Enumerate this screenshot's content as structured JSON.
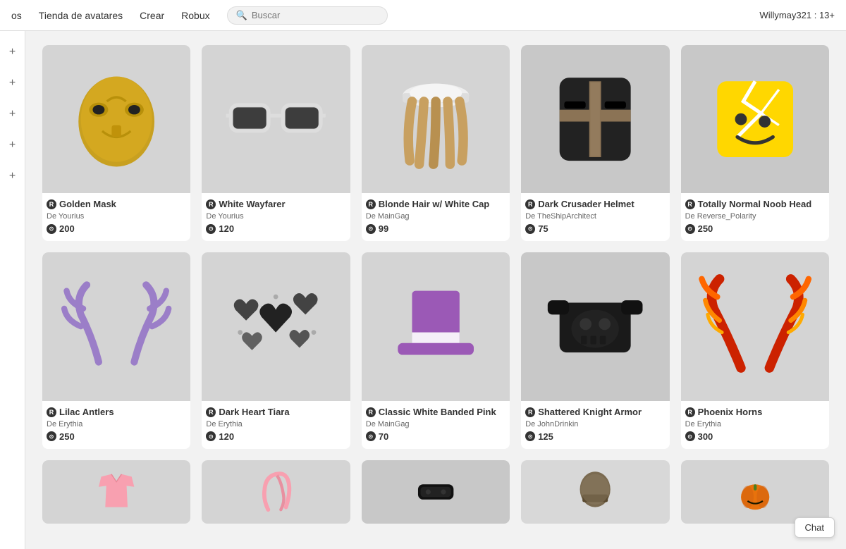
{
  "nav": {
    "items": [
      "os",
      "Tienda de avatares",
      "Crear",
      "Robux"
    ],
    "search_placeholder": "Buscar",
    "user": "Willymay321 : 13+"
  },
  "sidebar": {
    "icons": [
      "+",
      "+",
      "+",
      "+",
      "+"
    ]
  },
  "items": [
    {
      "id": "golden-mask",
      "name": "Golden Mask",
      "creator": "De Yourius",
      "price": "200",
      "img_type": "golden-mask"
    },
    {
      "id": "white-wayfarer",
      "name": "White Wayfarer",
      "creator": "De Yourius",
      "price": "120",
      "img_type": "white-wayfarer"
    },
    {
      "id": "blonde-hair",
      "name": "Blonde Hair w/ White Cap",
      "creator": "De MainGag",
      "price": "99",
      "img_type": "blonde-hair"
    },
    {
      "id": "dark-crusader",
      "name": "Dark Crusader Helmet",
      "creator": "De TheShipArchitect",
      "price": "75",
      "img_type": "dark-crusader"
    },
    {
      "id": "noob-head",
      "name": "Totally Normal Noob Head",
      "creator": "De Reverse_Polarity",
      "price": "250",
      "img_type": "noob-head"
    },
    {
      "id": "lilac-antlers",
      "name": "Lilac Antlers",
      "creator": "De Erythia",
      "price": "250",
      "img_type": "lilac-antlers"
    },
    {
      "id": "dark-heart",
      "name": "Dark Heart Tiara",
      "creator": "De Erythia",
      "price": "120",
      "img_type": "dark-heart"
    },
    {
      "id": "classic-pink",
      "name": "Classic White Banded Pink",
      "creator": "De MainGag",
      "price": "70",
      "img_type": "classic-pink"
    },
    {
      "id": "shattered",
      "name": "Shattered Knight Armor",
      "creator": "De JohnDrinkin",
      "price": "125",
      "img_type": "shattered"
    },
    {
      "id": "phoenix-horns",
      "name": "Phoenix Horns",
      "creator": "De Erythia",
      "price": "300",
      "img_type": "phoenix"
    },
    {
      "id": "pink-shirt",
      "name": "",
      "creator": "",
      "price": "",
      "img_type": "pink-shirt"
    },
    {
      "id": "pink-hair",
      "name": "",
      "creator": "",
      "price": "",
      "img_type": "pink-hair"
    },
    {
      "id": "black-item",
      "name": "",
      "creator": "",
      "price": "",
      "img_type": "black-item"
    },
    {
      "id": "helmet2",
      "name": "",
      "creator": "",
      "price": "",
      "img_type": "helmet2"
    },
    {
      "id": "pumpkin",
      "name": "",
      "creator": "",
      "price": "",
      "img_type": "pumpkin"
    }
  ],
  "chat_label": "Chat"
}
